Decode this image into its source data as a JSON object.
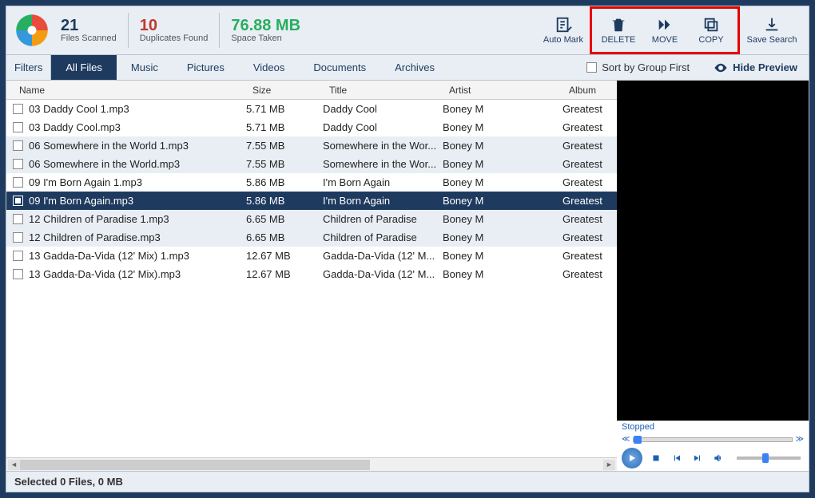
{
  "stats": {
    "scanned_num": "21",
    "scanned_label": "Files Scanned",
    "dup_num": "10",
    "dup_label": "Duplicates Found",
    "space_num": "76.88 MB",
    "space_label": "Space Taken"
  },
  "actions": {
    "auto_mark": "Auto Mark",
    "delete": "DELETE",
    "move": "MOVE",
    "copy": "COPY",
    "save_search": "Save Search"
  },
  "filters": {
    "label": "Filters",
    "tabs": [
      "All Files",
      "Music",
      "Pictures",
      "Videos",
      "Documents",
      "Archives"
    ],
    "sort_label": "Sort by Group First",
    "hide_preview": "Hide Preview"
  },
  "columns": {
    "name": "Name",
    "size": "Size",
    "title": "Title",
    "artist": "Artist",
    "album": "Album"
  },
  "rows": [
    {
      "name": "03 Daddy Cool 1.mp3",
      "size": "5.71 MB",
      "title": "Daddy Cool",
      "artist": "Boney M",
      "album": "Greatest",
      "alt": false
    },
    {
      "name": "03 Daddy Cool.mp3",
      "size": "5.71 MB",
      "title": "Daddy Cool",
      "artist": "Boney M",
      "album": "Greatest",
      "alt": false
    },
    {
      "name": "06 Somewhere in the World 1.mp3",
      "size": "7.55 MB",
      "title": "Somewhere in the Wor...",
      "artist": "Boney M",
      "album": "Greatest",
      "alt": true
    },
    {
      "name": "06 Somewhere in the World.mp3",
      "size": "7.55 MB",
      "title": "Somewhere in the Wor...",
      "artist": "Boney M",
      "album": "Greatest",
      "alt": true
    },
    {
      "name": "09 I'm Born Again 1.mp3",
      "size": "5.86 MB",
      "title": "I'm Born Again",
      "artist": "Boney M",
      "album": "Greatest",
      "alt": false
    },
    {
      "name": "09 I'm Born Again.mp3",
      "size": "5.86 MB",
      "title": "I'm Born Again",
      "artist": "Boney M",
      "album": "Greatest",
      "alt": false,
      "selected": true
    },
    {
      "name": "12 Children of Paradise 1.mp3",
      "size": "6.65 MB",
      "title": "Children of Paradise",
      "artist": "Boney M",
      "album": "Greatest",
      "alt": true
    },
    {
      "name": "12 Children of Paradise.mp3",
      "size": "6.65 MB",
      "title": "Children of Paradise",
      "artist": "Boney M",
      "album": "Greatest",
      "alt": true
    },
    {
      "name": "13 Gadda-Da-Vida (12' Mix) 1.mp3",
      "size": "12.67 MB",
      "title": "Gadda-Da-Vida (12' M...",
      "artist": "Boney M",
      "album": "Greatest",
      "alt": false
    },
    {
      "name": "13 Gadda-Da-Vida (12' Mix).mp3",
      "size": "12.67 MB",
      "title": "Gadda-Da-Vida (12' M...",
      "artist": "Boney M",
      "album": "Greatest",
      "alt": false
    }
  ],
  "player": {
    "status": "Stopped"
  },
  "statusbar": "Selected 0 Files, 0 MB"
}
